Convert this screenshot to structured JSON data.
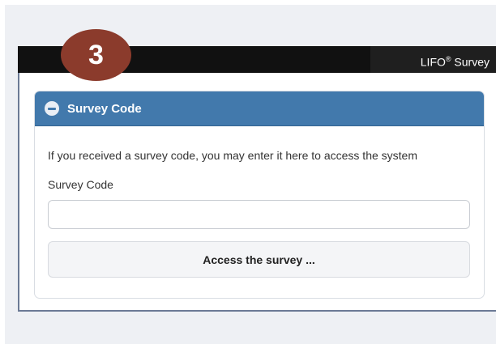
{
  "header": {
    "step_number": "3",
    "app_title": "LIFO",
    "app_title_mark": "®",
    "app_title_suffix": " Survey"
  },
  "panel": {
    "title": "Survey Code",
    "collapse_icon": "minus-circle-icon",
    "intro_text": "If you received a survey code, you may enter it here to access the system",
    "field_label": "Survey Code",
    "input_value": "",
    "input_placeholder": "",
    "submit_label": "Access the survey ..."
  },
  "colors": {
    "header_bar": "#111111",
    "badge": "#8b3b2c",
    "panel_header": "#4279ac",
    "button_bg": "#f4f5f7"
  }
}
